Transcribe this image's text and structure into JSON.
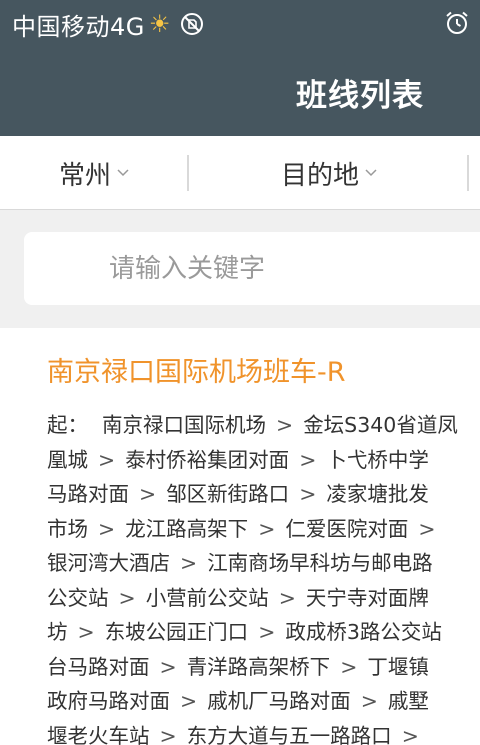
{
  "status_bar": {
    "carrier": "中国移动4G",
    "icons": [
      "sun-icon",
      "no-sim-icon",
      "alarm-clock-icon"
    ]
  },
  "header": {
    "title": "班线列表"
  },
  "filters": {
    "origin": "常州",
    "destination": "目的地"
  },
  "search": {
    "placeholder": "请输入关键字",
    "value": ""
  },
  "route": {
    "title": "南京禄口国际机场班车-R",
    "stops_prefix": "起：",
    "stops_lines": [
      [
        "南京禄口国际机场",
        "金坛S340省道凤"
      ],
      [
        "凰城",
        "泰村侨裕集团对面",
        "卜弋桥中学"
      ],
      [
        "马路对面",
        "邹区新街路口",
        "凌家塘批发"
      ],
      [
        "市场",
        "龙江路高架下",
        "仁爱医院对面",
        ""
      ],
      [
        "银河湾大酒店",
        "江南商场早科坊与邮电路"
      ],
      [
        "公交站",
        "小营前公交站",
        "天宁寺对面牌"
      ],
      [
        "坊",
        "东坡公园正门口",
        "政成桥3路公交站"
      ],
      [
        "台马路对面",
        "青洋路高架桥下",
        "丁堰镇"
      ],
      [
        "政府马路对面",
        "戚机厂马路对面",
        "戚墅"
      ],
      [
        "堰老火车站",
        "东方大道与五一路路口",
        ""
      ]
    ]
  },
  "colors": {
    "header_bg": "#46565f",
    "accent_orange": "#f0932b",
    "search_area_bg": "#f0f0f0"
  }
}
